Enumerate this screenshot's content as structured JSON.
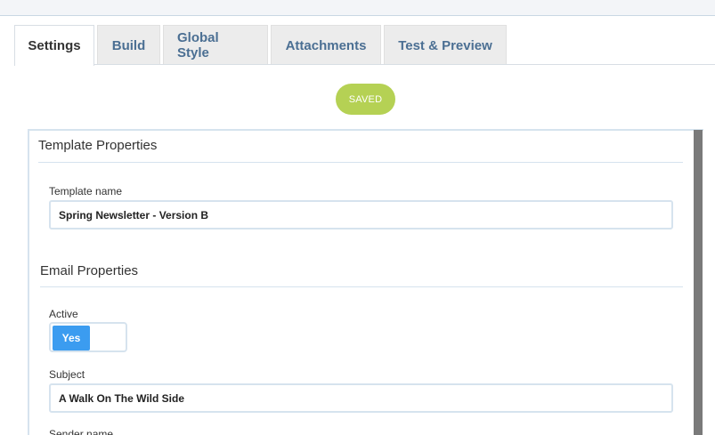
{
  "tabs": [
    {
      "label": "Settings",
      "active": true
    },
    {
      "label": "Build"
    },
    {
      "label": "Global Style"
    },
    {
      "label": "Attachments"
    },
    {
      "label": "Test & Preview"
    }
  ],
  "status": {
    "saved_label": "SAVED",
    "color": "#b5d154"
  },
  "template_properties": {
    "title": "Template Properties",
    "template_name_label": "Template name",
    "template_name_value": "Spring Newsletter - Version B"
  },
  "email_properties": {
    "title": "Email Properties",
    "active_label": "Active",
    "active_value": "Yes",
    "subject_label": "Subject",
    "subject_value": "A Walk On The Wild Side",
    "sender_name_label": "Sender name"
  },
  "colors": {
    "accent": "#3b9cf0",
    "tab_text": "#4b6f93"
  }
}
